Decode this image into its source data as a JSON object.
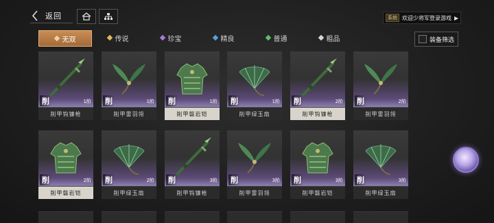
{
  "header": {
    "back_label": "返回",
    "home_icon": "home-icon",
    "map_icon": "structure-icon",
    "notice_tag": "系统",
    "notice_text": "欢迎少将军登录游戏"
  },
  "tabs": [
    {
      "label": "无双",
      "color": "#f2d2a8",
      "active": true
    },
    {
      "label": "传说",
      "color": "#e2b85a",
      "active": false
    },
    {
      "label": "珍宝",
      "color": "#a77bd6",
      "active": false
    },
    {
      "label": "精良",
      "color": "#5aa0d8",
      "active": false
    },
    {
      "label": "普通",
      "color": "#5fbf6a",
      "active": false
    },
    {
      "label": "粗品",
      "color": "#d8d8d8",
      "active": false
    }
  ],
  "filter_label": "装备筛选",
  "cut_mark": "削",
  "items": [
    {
      "name": "削甲钩镰枪",
      "tier": "1阶",
      "icon": "spear-icon",
      "highlight": false
    },
    {
      "name": "削甲雷羽翎",
      "tier": "1阶",
      "icon": "feather-plume-icon",
      "highlight": false
    },
    {
      "name": "削甲磐岩铠",
      "tier": "1阶",
      "icon": "armor-icon",
      "highlight": true
    },
    {
      "name": "削甲绿玉扇",
      "tier": "1阶",
      "icon": "fan-icon",
      "highlight": false
    },
    {
      "name": "削甲钩镰枪",
      "tier": "2阶",
      "icon": "spear-icon",
      "highlight": true
    },
    {
      "name": "削甲雷羽翎",
      "tier": "2阶",
      "icon": "feather-plume-icon",
      "highlight": false
    },
    {
      "name": "削甲磐岩铠",
      "tier": "2阶",
      "icon": "armor-icon",
      "highlight": true
    },
    {
      "name": "削甲绿玉扇",
      "tier": "2阶",
      "icon": "fan-icon",
      "highlight": false
    },
    {
      "name": "削甲钩镰枪",
      "tier": "3阶",
      "icon": "spear-icon",
      "highlight": false
    },
    {
      "name": "削甲雷羽翎",
      "tier": "3阶",
      "icon": "feather-plume-icon",
      "highlight": false
    },
    {
      "name": "削甲磐岩铠",
      "tier": "3阶",
      "icon": "armor-icon",
      "highlight": false
    },
    {
      "name": "削甲绿玉扇",
      "tier": "3阶",
      "icon": "fan-icon",
      "highlight": false
    }
  ],
  "avatar_icon": "character-avatar-icon"
}
